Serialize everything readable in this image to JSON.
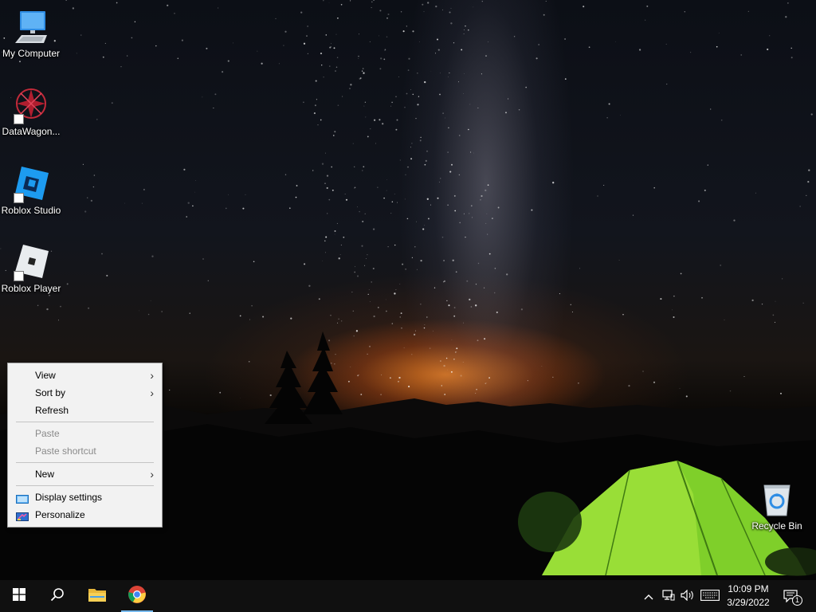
{
  "desktop": {
    "icons": [
      {
        "label": "My Computer",
        "icon": "computer-icon"
      },
      {
        "label": "DataWagon...",
        "icon": "datawagon-icon"
      },
      {
        "label": "Roblox Studio",
        "icon": "roblox-studio-icon"
      },
      {
        "label": "Roblox Player",
        "icon": "roblox-player-icon"
      },
      {
        "label": "Recycle Bin",
        "icon": "recycle-bin-icon"
      }
    ]
  },
  "context_menu": {
    "items": [
      {
        "label": "View",
        "submenu": true,
        "enabled": true
      },
      {
        "label": "Sort by",
        "submenu": true,
        "enabled": true
      },
      {
        "label": "Refresh",
        "enabled": true
      },
      {
        "label": "Paste",
        "enabled": false
      },
      {
        "label": "Paste shortcut",
        "enabled": false
      },
      {
        "label": "New",
        "submenu": true,
        "enabled": true
      },
      {
        "label": "Display settings",
        "icon": "display-icon",
        "enabled": true
      },
      {
        "label": "Personalize",
        "icon": "personalize-icon",
        "enabled": true
      }
    ],
    "submenu_glyph": "›"
  },
  "taskbar": {
    "pinned": [
      {
        "icon": "windows-start-icon"
      },
      {
        "icon": "search-icon"
      },
      {
        "icon": "file-explorer-icon"
      },
      {
        "icon": "chrome-icon",
        "active": true
      }
    ],
    "tray": {
      "icons": [
        "chevron-up-icon",
        "network-icon",
        "volume-icon",
        "keyboard-icon"
      ],
      "time": "10:09 PM",
      "date": "3/29/2022",
      "notification_count": "1"
    }
  },
  "colors": {
    "taskbar": "#101010",
    "menu_bg": "#f2f2f2",
    "accent": "#76b9ed"
  }
}
